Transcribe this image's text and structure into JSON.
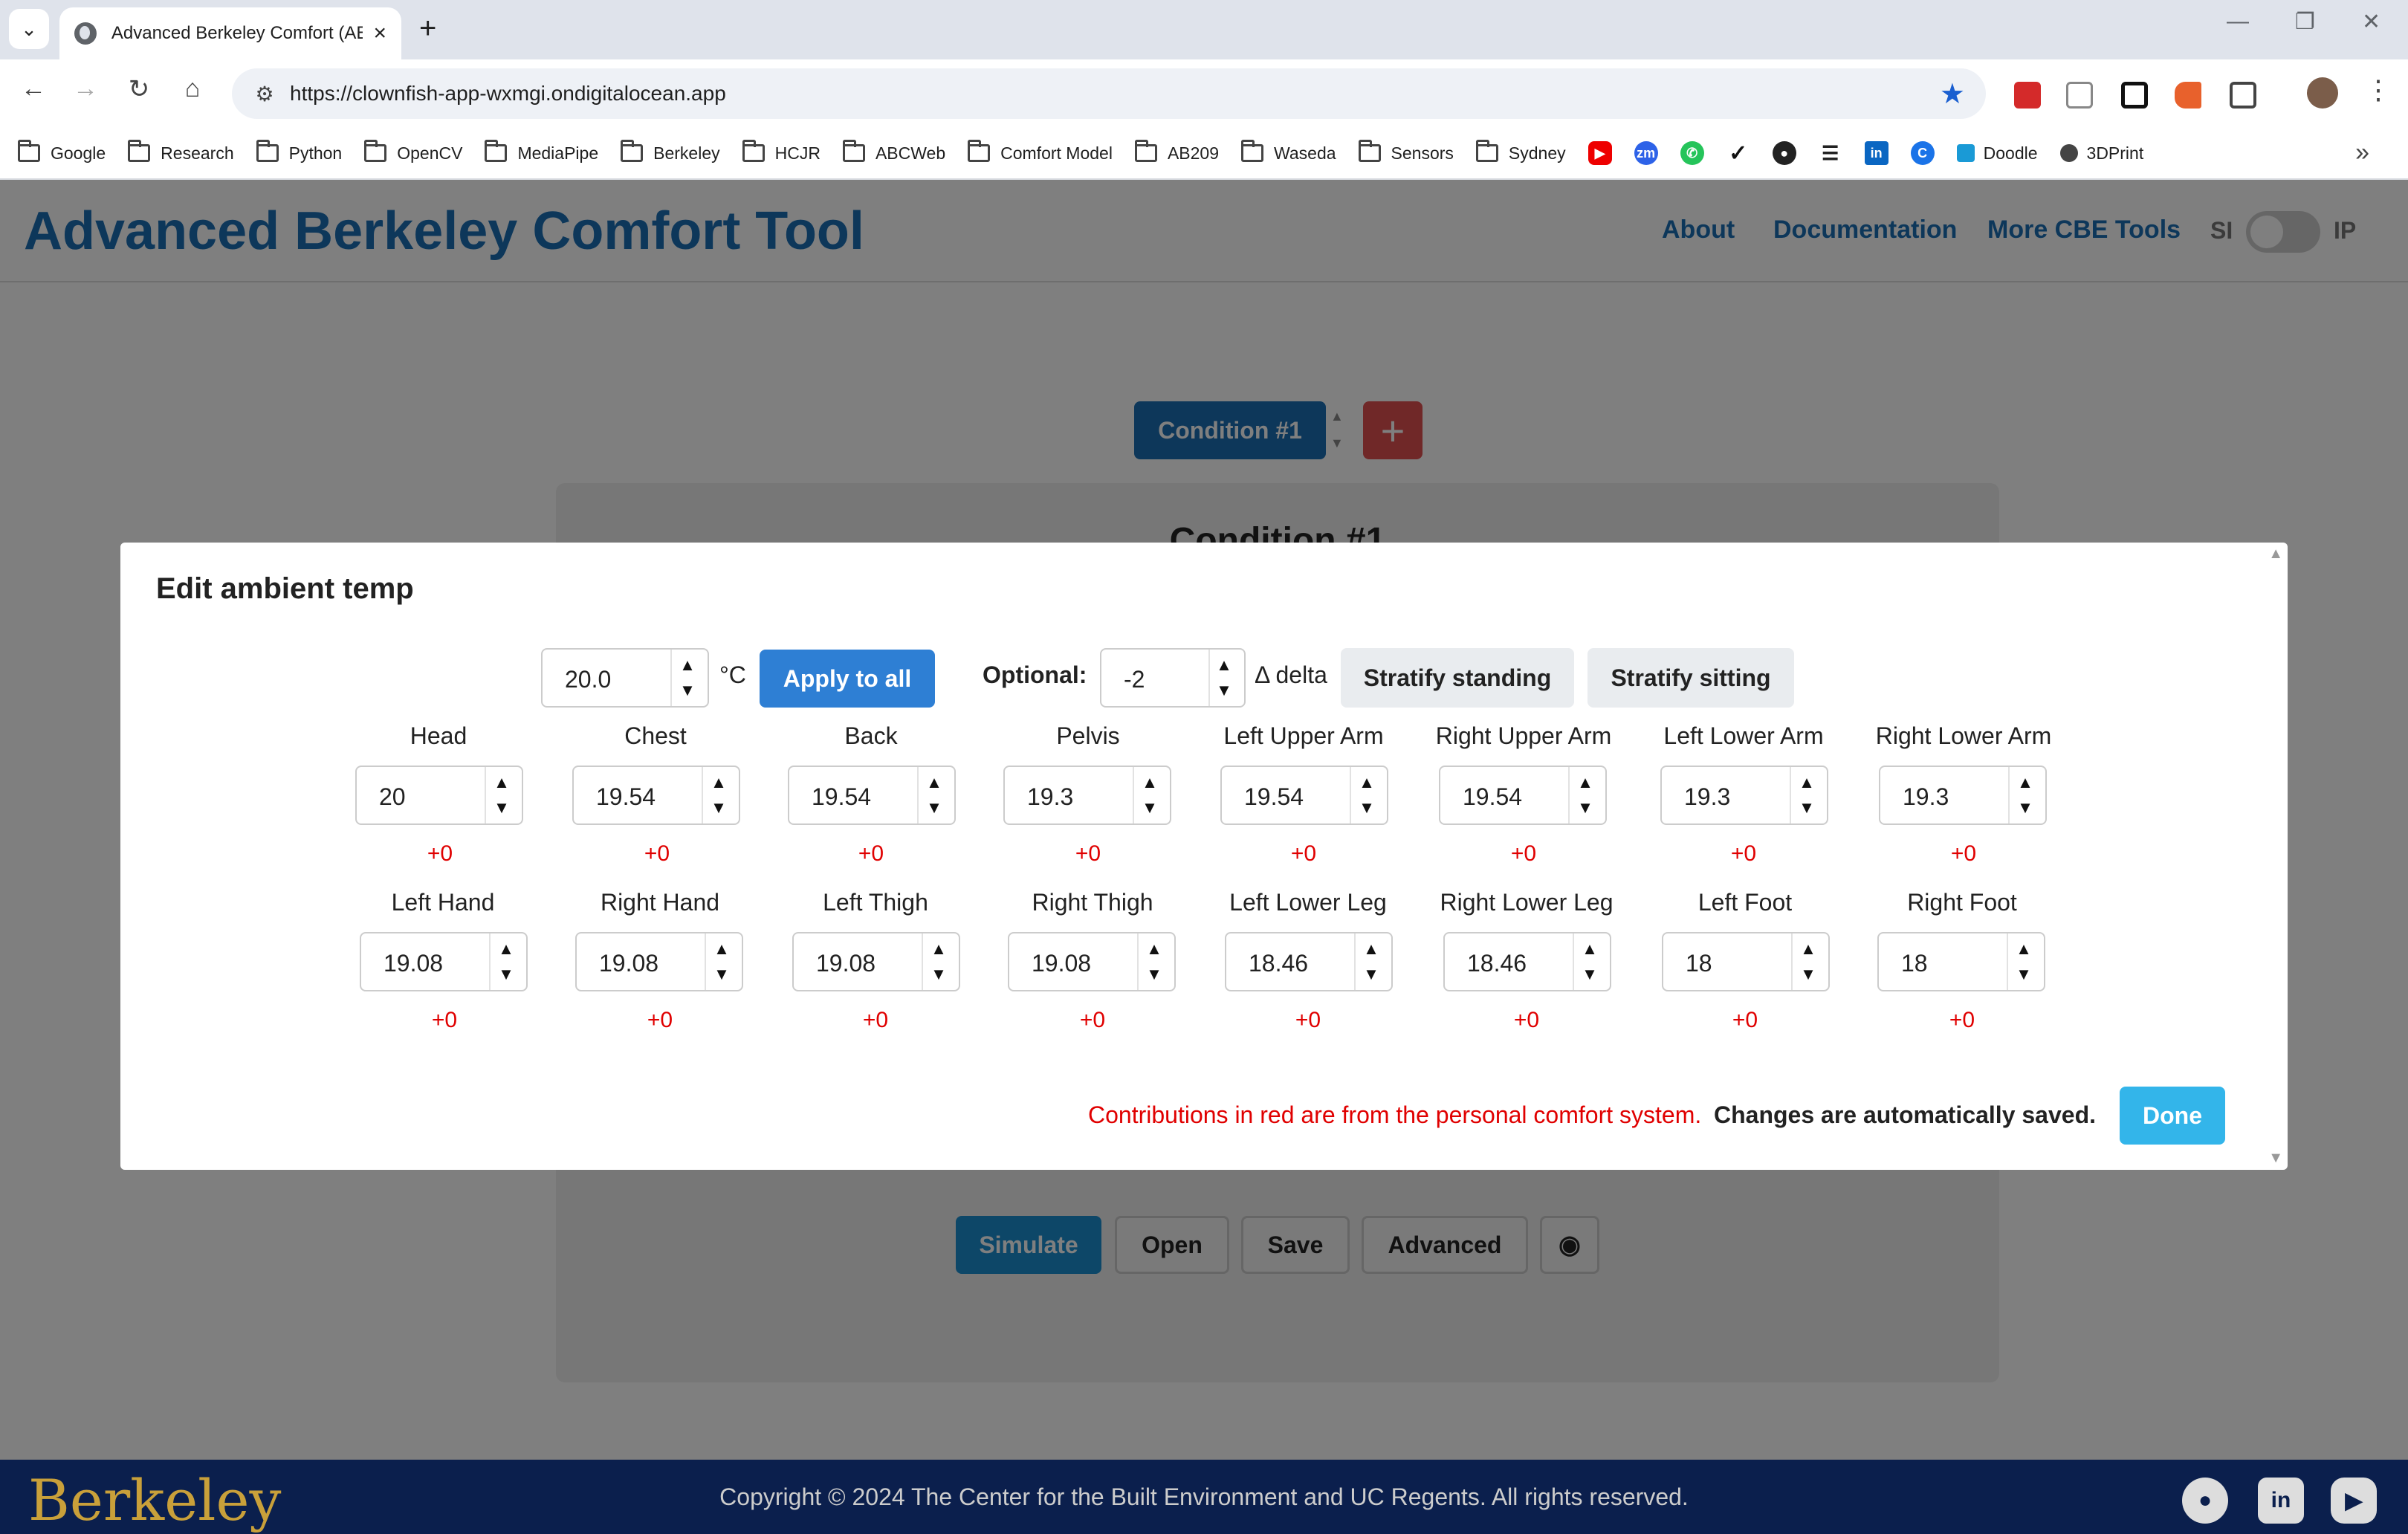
{
  "browser": {
    "tab_title": "Advanced Berkeley Comfort (AE",
    "url": "https://clownfish-app-wxmgi.ondigitalocean.app",
    "bookmarks": [
      "Google",
      "Research",
      "Python",
      "OpenCV",
      "MediaPipe",
      "Berkeley",
      "HCJR",
      "ABCWeb",
      "Comfort Model",
      "AB209",
      "Waseda",
      "Sensors",
      "Sydney"
    ],
    "bookmarks_extra": [
      "Doodle",
      "3DPrint"
    ]
  },
  "app": {
    "title": "Advanced Berkeley Comfort Tool",
    "nav": [
      "About",
      "Documentation",
      "More CBE Tools"
    ],
    "unit_si": "SI",
    "unit_ip": "IP",
    "condition_label": "Condition #1",
    "add_label": "+",
    "panel_title": "Condition #1",
    "buttons": {
      "simulate": "Simulate",
      "open": "Open",
      "save": "Save",
      "advanced": "Advanced"
    }
  },
  "modal": {
    "title": "Edit ambient temp",
    "global_value": "20.0",
    "unit": "°C",
    "apply_label": "Apply to all",
    "optional_label": "Optional:",
    "delta_value": "-2",
    "delta_label": "Δ delta",
    "stratify_standing": "Stratify standing",
    "stratify_sitting": "Stratify sitting",
    "parts_row1": [
      {
        "label": "Head",
        "value": "20",
        "pcs": "+0"
      },
      {
        "label": "Chest",
        "value": "19.54",
        "pcs": "+0"
      },
      {
        "label": "Back",
        "value": "19.54",
        "pcs": "+0"
      },
      {
        "label": "Pelvis",
        "value": "19.3",
        "pcs": "+0"
      },
      {
        "label": "Left Upper Arm",
        "value": "19.54",
        "pcs": "+0"
      },
      {
        "label": "Right Upper Arm",
        "value": "19.54",
        "pcs": "+0"
      },
      {
        "label": "Left Lower Arm",
        "value": "19.3",
        "pcs": "+0"
      },
      {
        "label": "Right Lower Arm",
        "value": "19.3",
        "pcs": "+0"
      }
    ],
    "parts_row2": [
      {
        "label": "Left Hand",
        "value": "19.08",
        "pcs": "+0"
      },
      {
        "label": "Right Hand",
        "value": "19.08",
        "pcs": "+0"
      },
      {
        "label": "Left Thigh",
        "value": "19.08",
        "pcs": "+0"
      },
      {
        "label": "Right Thigh",
        "value": "19.08",
        "pcs": "+0"
      },
      {
        "label": "Left Lower Leg",
        "value": "18.46",
        "pcs": "+0"
      },
      {
        "label": "Right Lower Leg",
        "value": "18.46",
        "pcs": "+0"
      },
      {
        "label": "Left Foot",
        "value": "18",
        "pcs": "+0"
      },
      {
        "label": "Right Foot",
        "value": "18",
        "pcs": "+0"
      }
    ],
    "note_red": "Contributions in red are from the personal comfort system.",
    "note_black": "Changes are automatically saved.",
    "done_label": "Done"
  },
  "footer": {
    "logo": "Berkeley",
    "copyright": "Copyright © 2024 The Center for the Built Environment and UC Regents. All rights reserved."
  },
  "colors": {
    "brand_blue": "#1a6fb5",
    "pcs_red": "#e00000",
    "done_cyan": "#33b5ea",
    "apply_blue": "#2e7fd4"
  }
}
